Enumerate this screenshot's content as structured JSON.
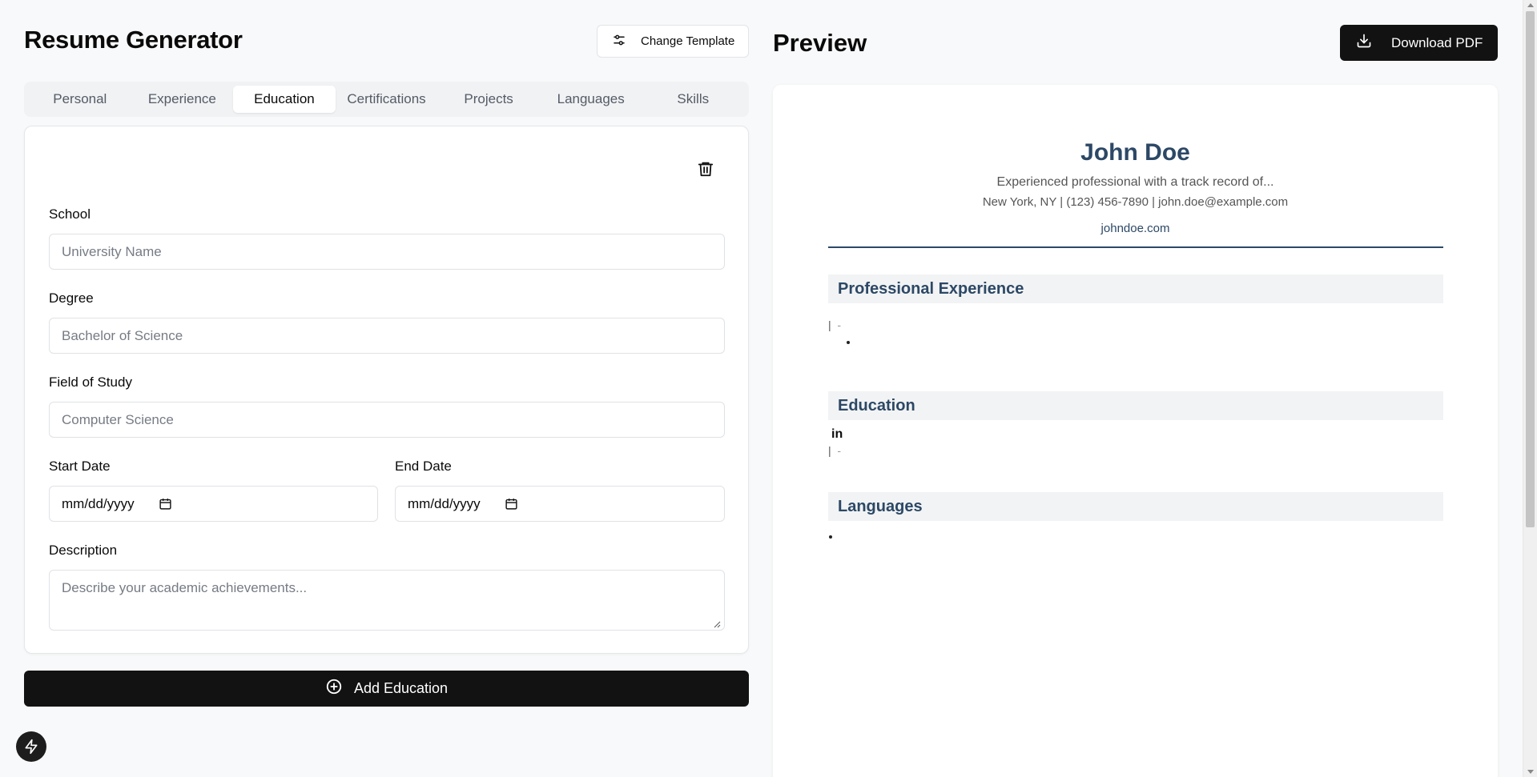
{
  "header": {
    "title": "Resume Generator",
    "change_template_label": "Change Template"
  },
  "tabs": [
    {
      "label": "Personal",
      "active": false
    },
    {
      "label": "Experience",
      "active": false
    },
    {
      "label": "Education",
      "active": true
    },
    {
      "label": "Certifications",
      "active": false
    },
    {
      "label": "Projects",
      "active": false
    },
    {
      "label": "Languages",
      "active": false
    },
    {
      "label": "Skills",
      "active": false
    }
  ],
  "education_form": {
    "school_label": "School",
    "school_placeholder": "University Name",
    "degree_label": "Degree",
    "degree_placeholder": "Bachelor of Science",
    "field_label": "Field of Study",
    "field_placeholder": "Computer Science",
    "start_label": "Start Date",
    "start_value": "mm/dd/yyyy",
    "end_label": "End Date",
    "end_value": "mm/dd/yyyy",
    "description_label": "Description",
    "description_placeholder": "Describe your academic achievements..."
  },
  "add_education_label": "Add Education",
  "preview": {
    "title": "Preview",
    "download_label": "Download PDF"
  },
  "resume": {
    "name": "John Doe",
    "summary": "Experienced professional with a track record of...",
    "contact": "New York, NY | (123) 456-7890 | john.doe@example.com",
    "website": "johndoe.com",
    "sections": {
      "experience": "Professional Experience",
      "education": "Education",
      "languages": "Languages"
    },
    "experience_meta": "-",
    "education_degree_line": "in",
    "education_meta": "-",
    "separator": "|"
  },
  "colors": {
    "accent": "#2c4866",
    "dark_button": "#121212",
    "background": "#f8f9fa"
  },
  "icons": {
    "change_template": "sliders-icon",
    "trash": "trash-icon",
    "add": "plus-circle-icon",
    "download": "download-icon",
    "fab": "lightning-icon"
  }
}
